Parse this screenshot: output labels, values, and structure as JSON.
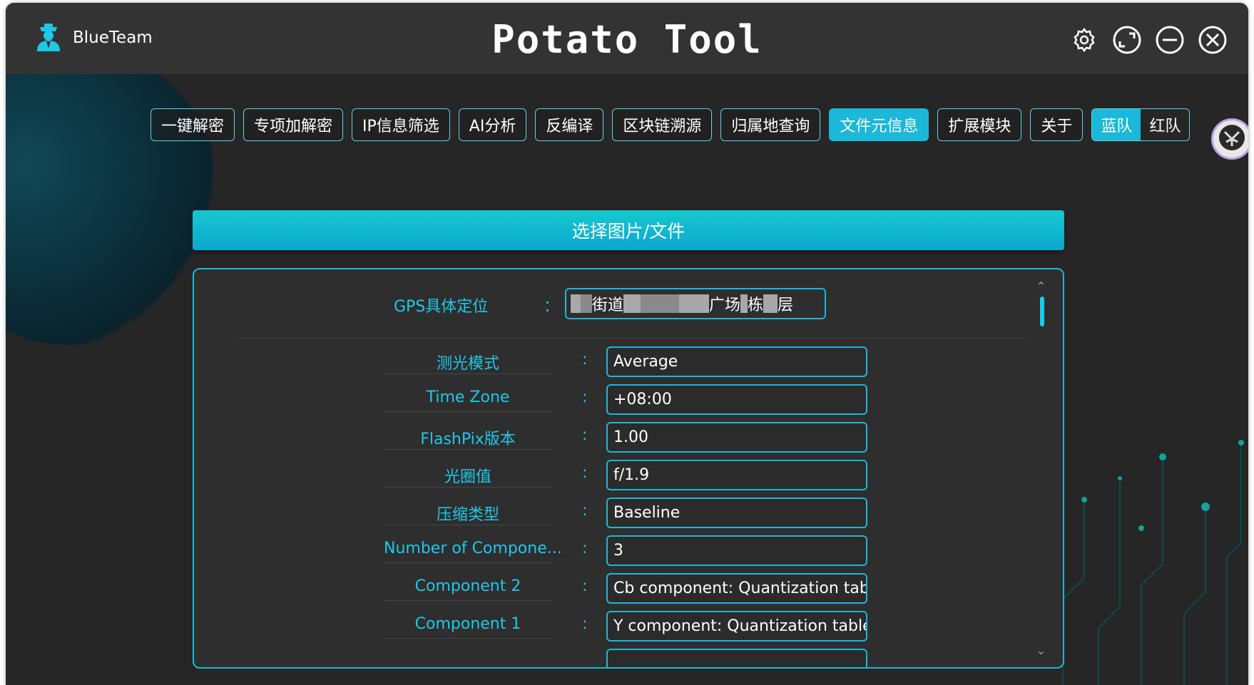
{
  "app": {
    "brand_name": "BlueTeam",
    "title": "Potato Tool",
    "accent_color": "#1ab8d9",
    "window_controls": [
      "gear-icon",
      "restore-icon",
      "minimize-icon",
      "close-icon"
    ]
  },
  "nav": {
    "items": [
      {
        "label": "一键解密",
        "active": false
      },
      {
        "label": "专项加解密",
        "active": false
      },
      {
        "label": "IP信息筛选",
        "active": false
      },
      {
        "label": "AI分析",
        "active": false
      },
      {
        "label": "反编译",
        "active": false
      },
      {
        "label": "区块链溯源",
        "active": false
      },
      {
        "label": "归属地查询",
        "active": false
      },
      {
        "label": "文件元信息",
        "active": true
      },
      {
        "label": "扩展模块",
        "active": false
      },
      {
        "label": "关于",
        "active": false
      }
    ],
    "team_toggle": {
      "blue": "蓝队",
      "red": "红队",
      "selected": "blue"
    }
  },
  "main": {
    "select_button": "选择图片/文件",
    "gps": {
      "label": "GPS具体定位",
      "colon": "：",
      "parts": [
        "街道",
        "广场",
        "栋",
        "层"
      ]
    },
    "rows": [
      {
        "label": "测光模式",
        "value": "Average"
      },
      {
        "label": "Time Zone",
        "value": "+08:00"
      },
      {
        "label": "FlashPix版本",
        "value": "1.00"
      },
      {
        "label": "光圈值",
        "value": "f/1.9"
      },
      {
        "label": "压缩类型",
        "value": "Baseline"
      },
      {
        "label": "Number of Compone...",
        "value": "3"
      },
      {
        "label": "Component 2",
        "value": "Cb component: Quantization tab"
      },
      {
        "label": "Component 1",
        "value": "Y component: Quantization table"
      }
    ],
    "colon": ":"
  }
}
